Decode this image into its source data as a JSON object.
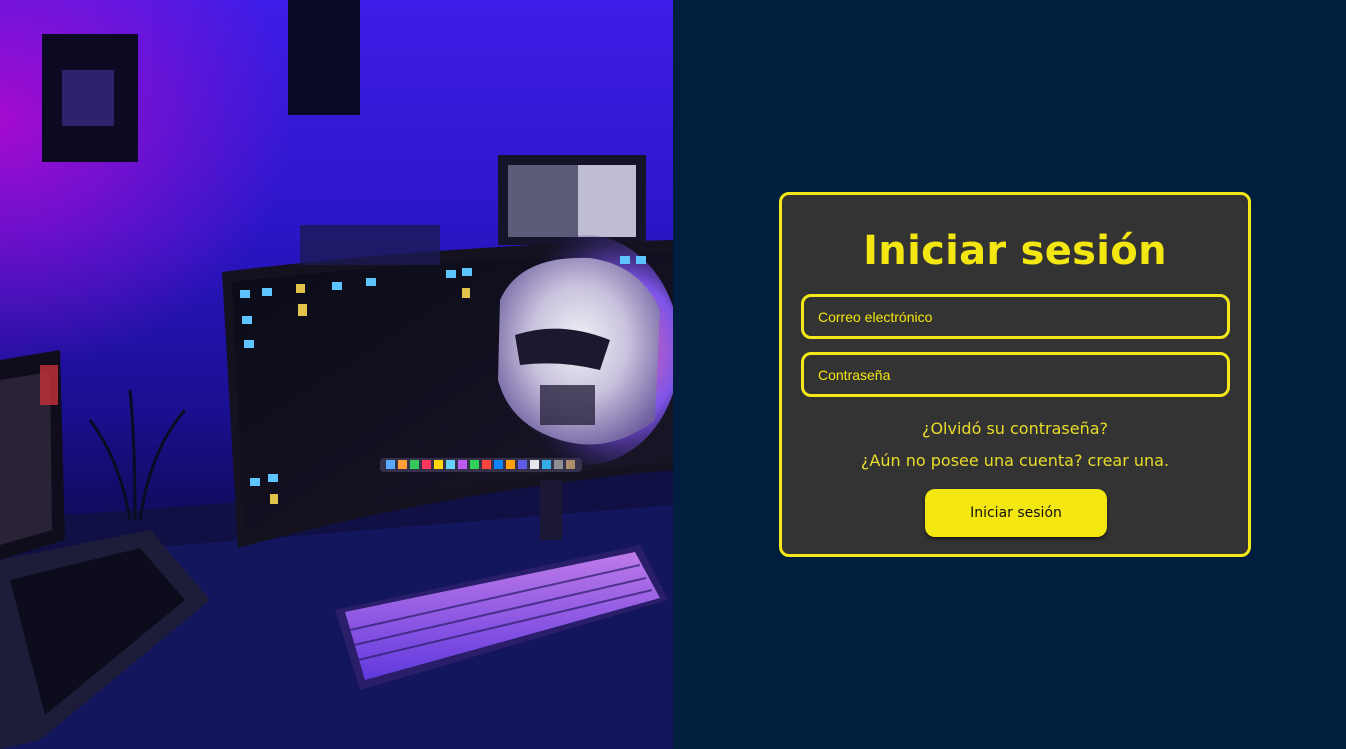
{
  "hero": {
    "image": "gaming-desk-setup-photo"
  },
  "login": {
    "title": "Iniciar sesión",
    "email_placeholder": "Correo electrónico",
    "password_placeholder": "Contraseña",
    "forgot_link": "¿Olvidó su contraseña?",
    "register_link": "¿Aún no posee una cuenta? crear una.",
    "submit_label": "Iniciar sesión"
  },
  "colors": {
    "background": "#001e3d",
    "card": "#333333",
    "accent": "#f4e711"
  }
}
